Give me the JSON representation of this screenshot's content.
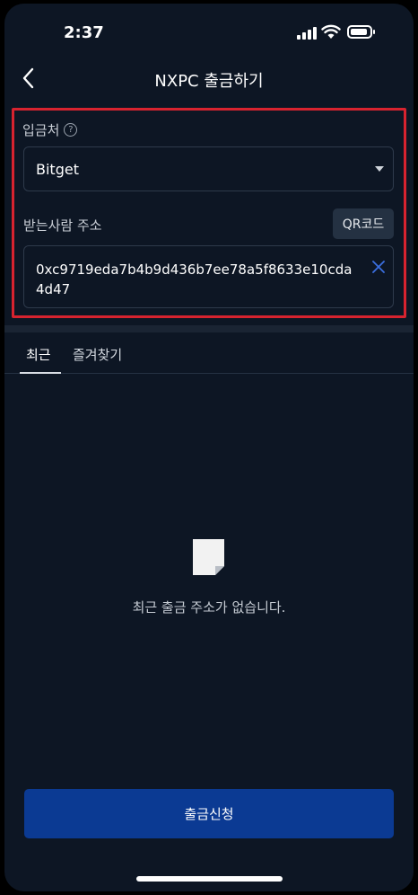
{
  "status_bar": {
    "time": "2:37"
  },
  "header": {
    "title": "NXPC 출금하기"
  },
  "form": {
    "destination_label": "입금처",
    "destination_value": "Bitget",
    "address_label": "받는사람 주소",
    "qr_button": "QR코드",
    "address_value": "0xc9719eda7b4b9d436b7ee78a5f8633e10cda4d47"
  },
  "tabs": [
    {
      "label": "최근",
      "active": true
    },
    {
      "label": "즐겨찾기",
      "active": false
    }
  ],
  "empty_state": {
    "message": "최근 출금 주소가 없습니다."
  },
  "submit_button": "출금신청",
  "colors": {
    "background": "#0d1624",
    "accent": "#0b3a93",
    "highlight_border": "#d7232f"
  }
}
